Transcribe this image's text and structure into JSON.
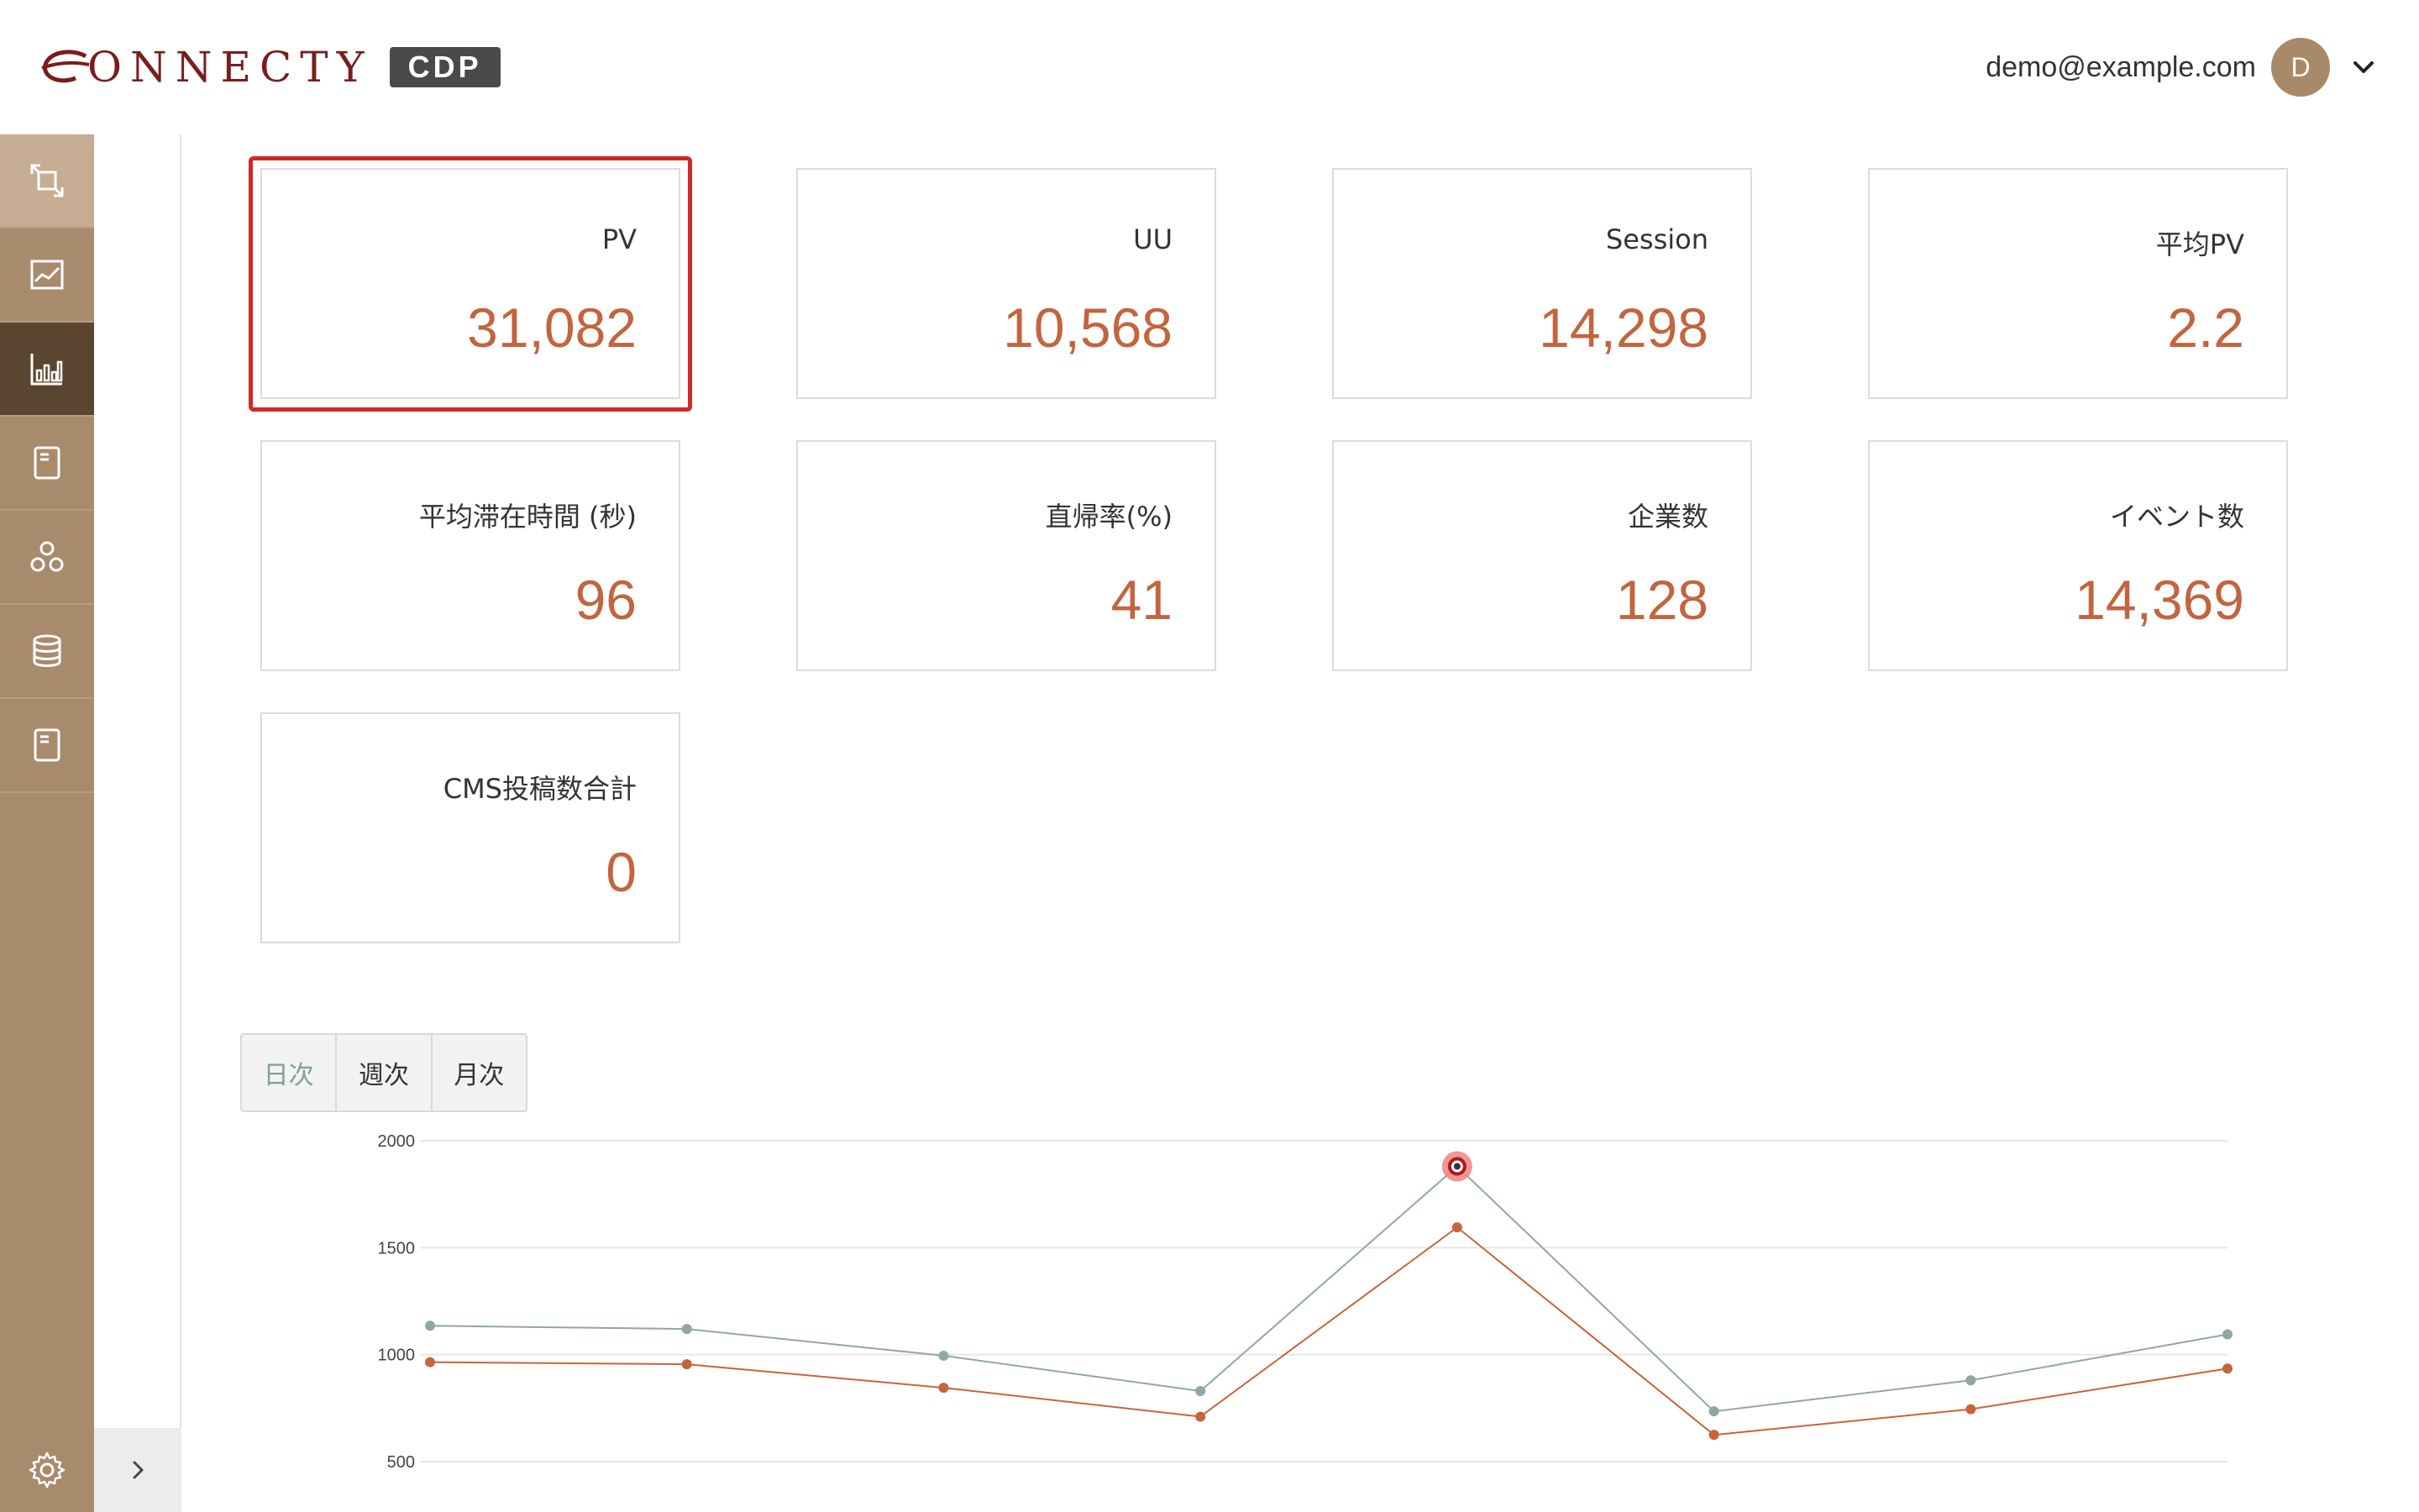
{
  "header": {
    "logo_text": "ONNECTY",
    "logo_badge": "CDP",
    "user_email": "demo@example.com",
    "avatar_initial": "D"
  },
  "sidebar": {
    "items": [
      {
        "icon": "transfer-icon"
      },
      {
        "icon": "line-chart-icon"
      },
      {
        "icon": "bar-chart-icon"
      },
      {
        "icon": "document-icon"
      },
      {
        "icon": "network-icon"
      },
      {
        "icon": "database-icon"
      },
      {
        "icon": "document-icon"
      }
    ],
    "settings_icon": "gear-icon",
    "collapse_icon": "chevron-right-icon"
  },
  "metrics": [
    {
      "label": "PV",
      "value": "31,082"
    },
    {
      "label": "UU",
      "value": "10,568"
    },
    {
      "label": "Session",
      "value": "14,298"
    },
    {
      "label": "平均PV",
      "value": "2.2"
    },
    {
      "label": "平均滞在時間 (秒)",
      "value": "96"
    },
    {
      "label": "直帰率(%)",
      "value": "41"
    },
    {
      "label": "企業数",
      "value": "128"
    },
    {
      "label": "イベント数",
      "value": "14,369"
    },
    {
      "label": "CMS投稿数合計",
      "value": "0"
    }
  ],
  "period_toggle": {
    "options": [
      "日次",
      "週次",
      "月次"
    ],
    "selected": "日次"
  },
  "colors": {
    "accent": "#c2653e",
    "sidebar": "#a88a6d",
    "sidebar_active": "#5a4530",
    "highlight": "#d12828",
    "series_gray": "#8fa8a1",
    "series_orange": "#c8643a"
  },
  "chart_data": {
    "type": "line",
    "x": [
      1,
      2,
      3,
      4,
      5,
      6,
      7,
      8
    ],
    "ylim": [
      500,
      2000
    ],
    "yticks": [
      "2000",
      "1500",
      "1000",
      "500"
    ],
    "grid": true,
    "series": [
      {
        "color": "#8fa8a1",
        "values": [
          1135,
          1120,
          995,
          830,
          1880,
          735,
          880,
          1095
        ]
      },
      {
        "color": "#c8643a",
        "values": [
          965,
          955,
          845,
          710,
          1595,
          625,
          745,
          935
        ]
      }
    ],
    "highlight_point": {
      "series": 0,
      "index": 4
    }
  }
}
